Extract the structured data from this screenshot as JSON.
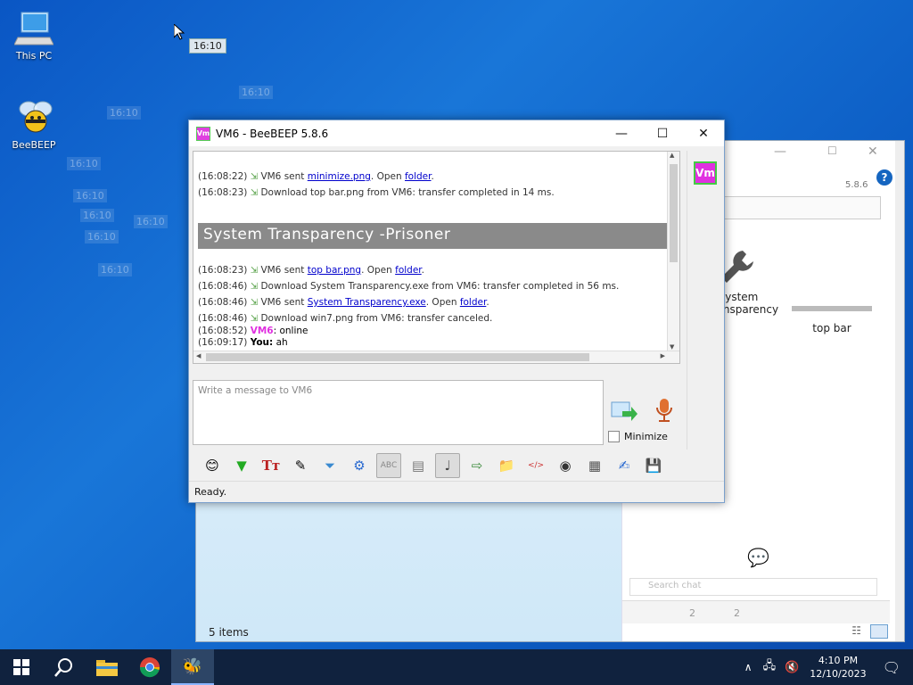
{
  "desktop": {
    "icons": [
      {
        "label": "This PC"
      },
      {
        "label": "BeeBEEP"
      }
    ],
    "time_tooltip": "16:10",
    "ghost_times": [
      "16:10",
      "16:10",
      "16:10",
      "16:10",
      "16:10",
      "16:10",
      "16:10",
      "16:10"
    ]
  },
  "explorer": {
    "status": "5 items",
    "version": "5.8.6",
    "search_placeholder": "Search chat",
    "files": [
      {
        "label": "System\nTransparency"
      },
      {
        "label": "top bar"
      }
    ],
    "bottom_counts": [
      "2",
      "2"
    ]
  },
  "window": {
    "title": "VM6 - BeeBEEP 5.8.6",
    "minimize_label": "—",
    "maximize_label": "☐",
    "close_label": "✕",
    "user_badge": "Vm",
    "chat": {
      "lines": [
        {
          "time": "(16:08:22)",
          "pre": "VM6 sent ",
          "link": "minimize.png",
          "mid": ". Open ",
          "link2": "folder",
          "post": "."
        },
        {
          "time": "(16:08:23)",
          "text": "Download top bar.png from VM6: transfer completed in 14 ms."
        },
        {
          "time": "(16:08:23)",
          "pre": "VM6 sent ",
          "link": "top bar.png",
          "mid": ". Open ",
          "link2": "folder",
          "post": "."
        },
        {
          "time": "(16:08:46)",
          "text": "Download System Transparency.exe from VM6: transfer completed in 56 ms."
        },
        {
          "time": "(16:08:46)",
          "pre": "VM6 sent ",
          "link": "System Transparency.exe",
          "mid": ". Open ",
          "link2": "folder",
          "post": "."
        },
        {
          "time": "(16:08:46)",
          "text": "Download win7.png from VM6: transfer canceled."
        }
      ],
      "banner": "System Transparency     -Prisoner",
      "status_line": {
        "time": "(16:08:52)",
        "user": "VM6",
        "text": ": online"
      },
      "you_line": {
        "time": "(16:09:17)",
        "user": "You:",
        "text": " ah"
      }
    },
    "input_placeholder": "Write a message to VM6",
    "minimize_checkbox": "Minimize",
    "status": "Ready."
  },
  "taskbar": {
    "time": "4:10 PM",
    "date": "12/10/2023"
  },
  "colors": {
    "accent": "#e030e0",
    "link": "#0000cc",
    "banner": "#8a8a8a"
  }
}
